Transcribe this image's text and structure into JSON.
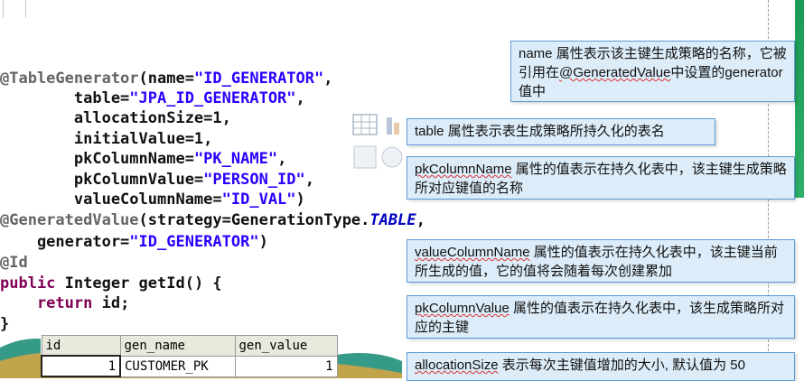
{
  "code": {
    "l1": {
      "ann": "@TableGenerator",
      "a": "(name=",
      "s": "\"ID_GENERATOR\"",
      "b": ","
    },
    "l2": {
      "a": "        table=",
      "s": "\"JPA_ID_GENERATOR\"",
      "b": ","
    },
    "l3": {
      "a": "        allocationSize=1,"
    },
    "l4": {
      "a": "        initialValue=1,"
    },
    "l5": {
      "a": "        pkColumnName=",
      "s": "\"PK_NAME\"",
      "b": ","
    },
    "l6": {
      "a": "        pkColumnValue=",
      "s": "\"PERSON_ID\"",
      "b": ","
    },
    "l7": {
      "a": "        valueColumnName=",
      "s": "\"ID_VAL\"",
      "b": ")"
    },
    "l8": {
      "ann": "@GeneratedValue",
      "a": "(strategy=GenerationType.",
      "it": "TABLE",
      "b": ","
    },
    "l9": {
      "a": "    generator=",
      "s": "\"ID_GENERATOR\"",
      "b": ")"
    },
    "l10": {
      "ann": "@Id"
    },
    "l11": {
      "kw": "public",
      "a": " Integer getId() {"
    },
    "l12": {
      "kw": "    return",
      "a": " id;"
    },
    "l13": {
      "a": "}"
    }
  },
  "callouts": {
    "c1": {
      "pre": "name 属性表示该主键生成策略的名称，它被引用在",
      "ul": "@GeneratedValue",
      "post": "中设置的generator 值中"
    },
    "c2": {
      "text": "table 属性表示表生成策略所持久化的表名"
    },
    "c3": {
      "pre": "",
      "ul": "pkColumnName",
      "post": " 属性的值表示在持久化表中，该主键生成策略所对应键值的名称"
    },
    "c4": {
      "pre": "",
      "ul": "valueColumnName",
      "post": " 属性的值表示在持久化表中，该主键当前所生成的值，它的值将会随着每次创建累加"
    },
    "c5": {
      "pre": "",
      "ul": "pkColumnValue",
      "post": " 属性的值表示在持久化表中，该生成策略所对应的主键"
    },
    "c6": {
      "pre": "",
      "ul": "allocationSize",
      "post": " 表示每次主键值增加的大小, 默认值为 50"
    }
  },
  "table": {
    "headers": [
      "id",
      "gen_name",
      "gen_value"
    ],
    "row": [
      "1",
      "CUSTOMER_PK",
      "1"
    ]
  },
  "colors": {
    "string": "#2a00ff",
    "annotation": "#646464",
    "keyword": "#7f0055",
    "callout_bg": "#dcecf8",
    "callout_border": "#5b9bd5"
  }
}
